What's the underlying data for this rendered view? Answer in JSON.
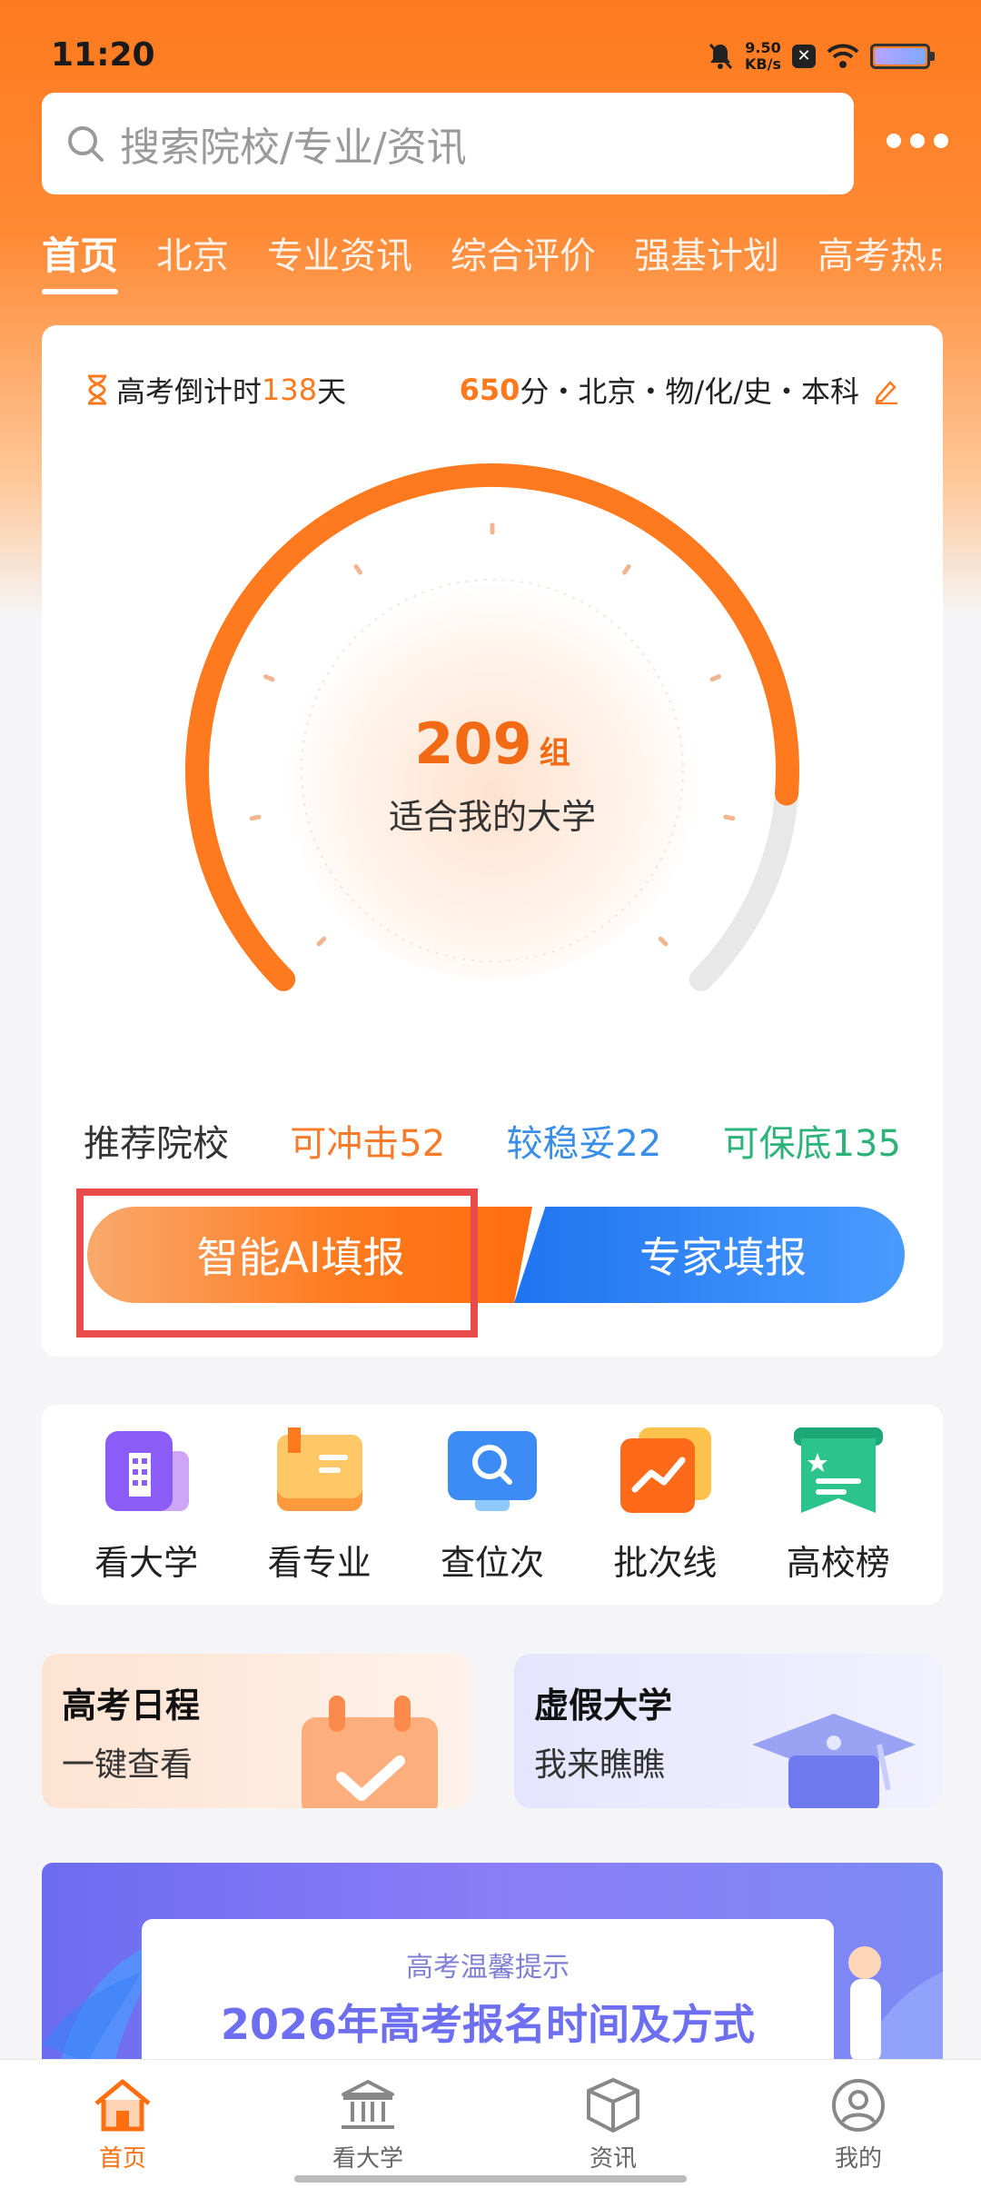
{
  "status_bar": {
    "time": "11:20",
    "net_speed_value": "9.50",
    "net_speed_unit": "KB/s",
    "icons": [
      "mute-bell-icon",
      "x-badge-icon",
      "wifi-icon",
      "battery-icon"
    ]
  },
  "search": {
    "placeholder": "搜索院校/专业/资讯"
  },
  "tabs": [
    "首页",
    "北京",
    "专业资讯",
    "综合评价",
    "强基计划",
    "高考热点"
  ],
  "active_tab": "首页",
  "profile": {
    "countdown_prefix": "高考倒计时",
    "countdown_days": "138",
    "countdown_suffix": "天",
    "score": "650",
    "score_rest": "分・北京・物/化/史・本科"
  },
  "gauge": {
    "count": "209",
    "unit": "组",
    "label": "适合我的大学",
    "progress_fraction": 0.85
  },
  "recommend": {
    "title": "推荐院校",
    "rush": "可冲击52",
    "stable": "较稳妥22",
    "safe": "可保底135"
  },
  "buttons": {
    "ai": "智能AI填报",
    "expert": "专家填报"
  },
  "quick_links": [
    {
      "label": "看大学",
      "icon": "building-icon"
    },
    {
      "label": "看专业",
      "icon": "book-icon"
    },
    {
      "label": "查位次",
      "icon": "search-monitor-icon"
    },
    {
      "label": "批次线",
      "icon": "trend-chart-icon"
    },
    {
      "label": "高校榜",
      "icon": "ranking-ribbon-icon"
    }
  ],
  "promos": [
    {
      "title": "高考日程",
      "sub": "一键查看",
      "icon": "calendar-check-icon"
    },
    {
      "title": "虚假大学",
      "sub": "我来瞧瞧",
      "icon": "graduation-cap-icon"
    }
  ],
  "banner": {
    "small": "高考温馨提示",
    "big": "2026年高考报名时间及方式"
  },
  "bottom_nav": [
    {
      "label": "首页",
      "icon": "home-icon",
      "active": true
    },
    {
      "label": "看大学",
      "icon": "university-icon",
      "active": false
    },
    {
      "label": "资讯",
      "icon": "box-icon",
      "active": false
    },
    {
      "label": "我的",
      "icon": "user-icon",
      "active": false
    }
  ],
  "colors": {
    "brand_orange": "#ff7a1e",
    "expert_blue": "#2f80f0",
    "safe_green": "#2cb37a",
    "highlight_red": "#e94b4b"
  }
}
